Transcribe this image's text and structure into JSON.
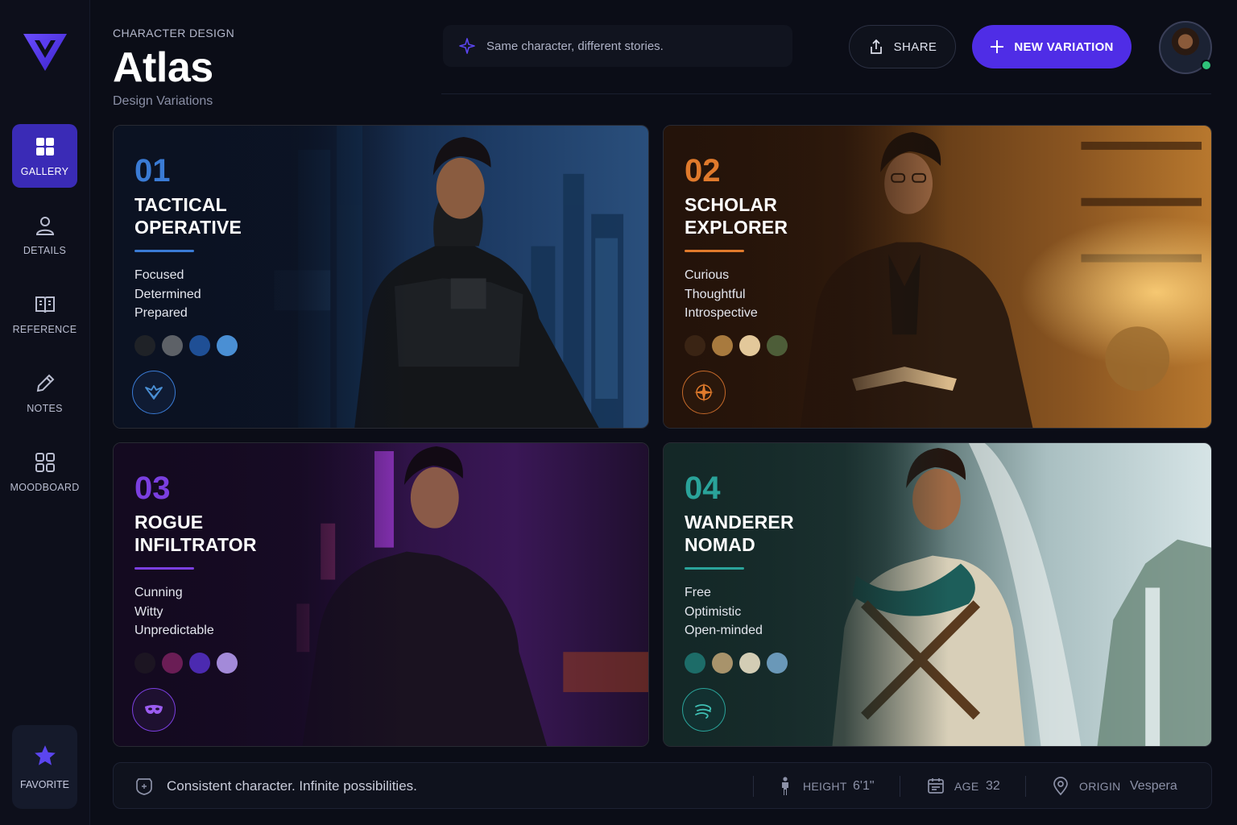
{
  "sidebar": {
    "items": [
      {
        "label": "GALLERY",
        "icon": "grid-icon",
        "active": true
      },
      {
        "label": "DETAILS",
        "icon": "user-icon",
        "active": false
      },
      {
        "label": "REFERENCE",
        "icon": "book-icon",
        "active": false
      },
      {
        "label": "NOTES",
        "icon": "pencil-icon",
        "active": false
      },
      {
        "label": "MOODBOARD",
        "icon": "moodboard-grid-icon",
        "active": false
      }
    ],
    "favorite": {
      "label": "FAVORITE",
      "icon": "star-icon"
    }
  },
  "header": {
    "eyebrow": "CHARACTER DESIGN",
    "title": "Atlas",
    "subtitle": "Design Variations",
    "tagline": "Same character, different stories.",
    "share_label": "SHARE",
    "new_variation_label": "NEW VARIATION"
  },
  "colors": {
    "accent": "#4f2de6",
    "tactical": "#3a7bd5",
    "scholar": "#e07a2c",
    "rogue": "#7b3fe0",
    "wanderer": "#2aa39a"
  },
  "cards": [
    {
      "number": "01",
      "title": "TACTICAL\nOPERATIVE",
      "traits": [
        "Focused",
        "Determined",
        "Prepared"
      ],
      "swatches": [
        "#1f2227",
        "#5d6167",
        "#1f4f95",
        "#4a8fd4"
      ],
      "emblem": "wings-emblem-icon"
    },
    {
      "number": "02",
      "title": "SCHOLAR\nEXPLORER",
      "traits": [
        "Curious",
        "Thoughtful",
        "Introspective"
      ],
      "swatches": [
        "#3a2414",
        "#a87a3e",
        "#e3c89a",
        "#4d5d38"
      ],
      "emblem": "compass-emblem-icon"
    },
    {
      "number": "03",
      "title": "ROGUE\nINFILTRATOR",
      "traits": [
        "Cunning",
        "Witty",
        "Unpredictable"
      ],
      "swatches": [
        "#1c1522",
        "#6a1d55",
        "#4b2ab0",
        "#a38ad9"
      ],
      "emblem": "mask-emblem-icon"
    },
    {
      "number": "04",
      "title": "WANDERER\nNOMAD",
      "traits": [
        "Free",
        "Optimistic",
        "Open-minded"
      ],
      "swatches": [
        "#1d6c68",
        "#a8936b",
        "#d3cdb5",
        "#6a98b8"
      ],
      "emblem": "wind-emblem-icon"
    }
  ],
  "footer": {
    "motto": "Consistent character. Infinite possibilities.",
    "height_label": "HEIGHT",
    "height_value": "6'1\"",
    "age_label": "AGE",
    "age_value": "32",
    "origin_label": "ORIGIN",
    "origin_value": "Vespera"
  }
}
